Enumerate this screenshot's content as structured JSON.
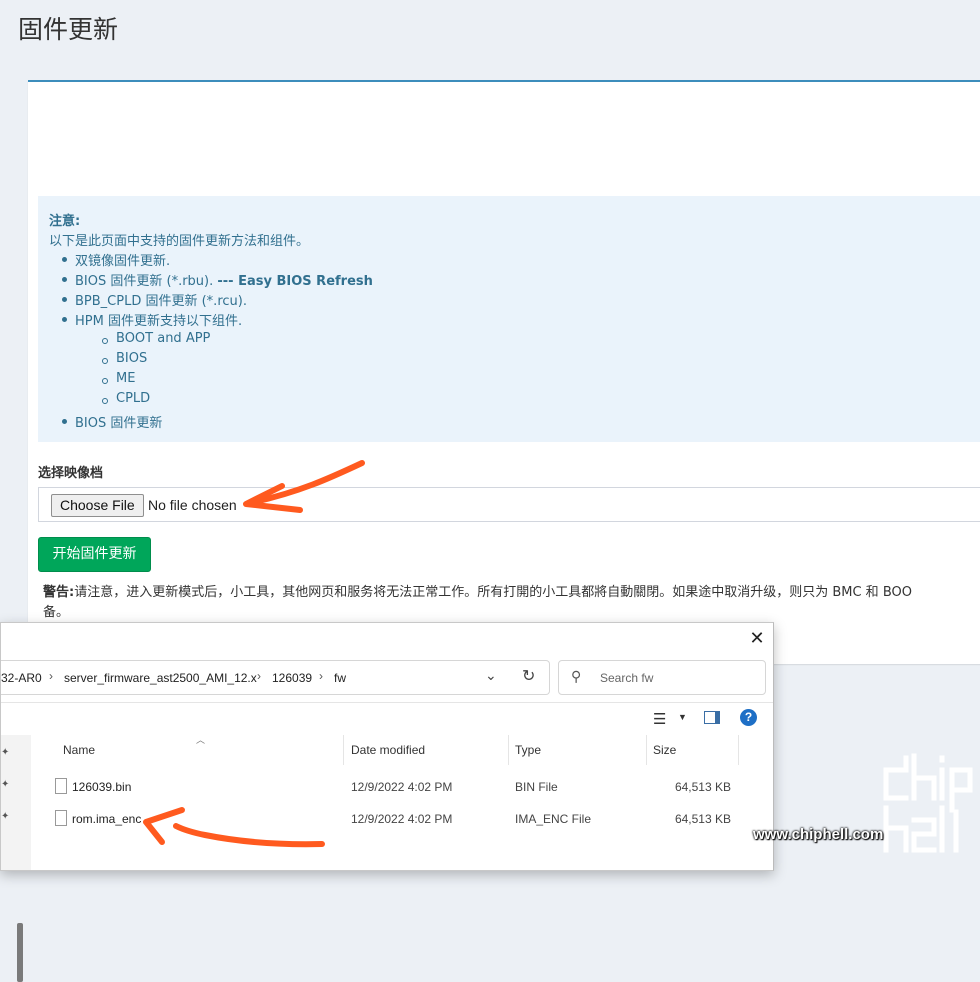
{
  "page": {
    "title": "固件更新"
  },
  "notice": {
    "header": "注意:",
    "intro": "以下是此页面中支持的固件更新方法和组件。",
    "items": [
      {
        "text": "双镜像固件更新."
      },
      {
        "text": "BIOS 固件更新 (*.rbu). ",
        "strong": "--- Easy BIOS Refresh"
      },
      {
        "text": "BPB_CPLD 固件更新 (*.rcu)."
      },
      {
        "text": "HPM 固件更新支持以下组件."
      },
      {
        "text": "BIOS 固件更新"
      }
    ],
    "subitems": [
      "BOOT and APP",
      "BIOS",
      "ME",
      "CPLD"
    ]
  },
  "form": {
    "label": "选择映像档",
    "choose_button": "Choose File",
    "no_file_text": "No file chosen",
    "start_button": "开始固件更新"
  },
  "warning": {
    "prefix": "警告:",
    "line1": "请注意，进入更新模式后，小工具，其他网页和服务将无法正常工作。所有打開的小工具都將自動關閉。如果途中取消升级，则只为 BMC 和 BOO",
    "line2": "备。"
  },
  "dialog": {
    "breadcrumb": [
      "32-AR0",
      "server_firmware_ast2500_AMI_12.x",
      "126039",
      "fw"
    ],
    "search_placeholder": "Search fw",
    "columns": [
      "Name",
      "Date modified",
      "Type",
      "Size"
    ],
    "files": [
      {
        "name": "126039.bin",
        "date": "12/9/2022 4:02 PM",
        "type": "BIN File",
        "size": "64,513 KB"
      },
      {
        "name": "rom.ima_enc",
        "date": "12/9/2022 4:02 PM",
        "type": "IMA_ENC File",
        "size": "64,513 KB"
      }
    ]
  },
  "watermark": {
    "text": "www.chiphell.com",
    "logo": "chip hell"
  },
  "colors": {
    "accent": "#3c8dbc",
    "success": "#00a65a",
    "callout_bg": "#eaf3fb",
    "callout_text": "#31708f",
    "annotation": "#ff5a1f"
  },
  "icons": [
    "close-icon",
    "chevron-down-icon",
    "refresh-icon",
    "search-icon",
    "view-list-icon",
    "preview-pane-icon",
    "help-icon",
    "pin-icon",
    "file-icon"
  ]
}
